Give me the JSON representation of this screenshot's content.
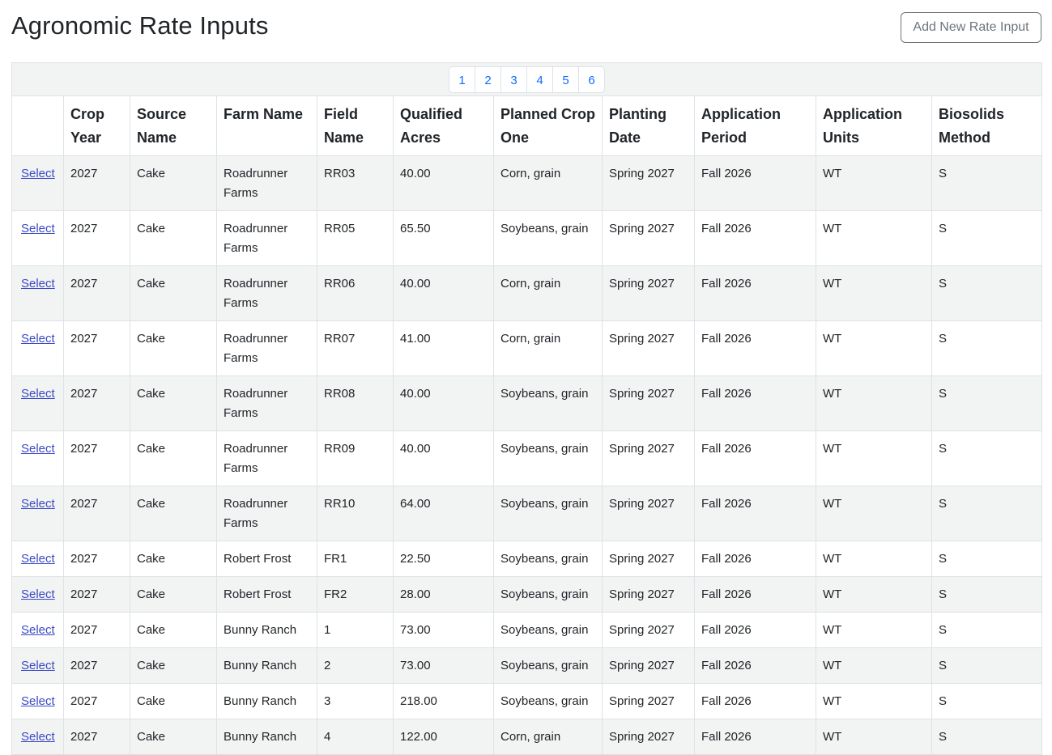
{
  "page": {
    "title": "Agronomic Rate Inputs",
    "add_button_label": "Add New Rate Input"
  },
  "pagination": {
    "pages": [
      "1",
      "2",
      "3",
      "4",
      "5",
      "6"
    ]
  },
  "columns": [
    "",
    "Crop Year",
    "Source Name",
    "Farm Name",
    "Field Name",
    "Qualified Acres",
    "Planned Crop One",
    "Planting Date",
    "Application Period",
    "Application Units",
    "Biosolids Method"
  ],
  "rows": [
    {
      "action": "Select",
      "crop_year": "2027",
      "source": "Cake",
      "farm": "Roadrunner Farms",
      "field": "RR03",
      "acres": "40.00",
      "crop": "Corn, grain",
      "planting": "Spring 2027",
      "period": "Fall 2026",
      "units": "WT",
      "method": "S"
    },
    {
      "action": "Select",
      "crop_year": "2027",
      "source": "Cake",
      "farm": "Roadrunner Farms",
      "field": "RR05",
      "acres": "65.50",
      "crop": "Soybeans, grain",
      "planting": "Spring 2027",
      "period": "Fall 2026",
      "units": "WT",
      "method": "S"
    },
    {
      "action": "Select",
      "crop_year": "2027",
      "source": "Cake",
      "farm": "Roadrunner Farms",
      "field": "RR06",
      "acres": "40.00",
      "crop": "Corn, grain",
      "planting": "Spring 2027",
      "period": "Fall 2026",
      "units": "WT",
      "method": "S"
    },
    {
      "action": "Select",
      "crop_year": "2027",
      "source": "Cake",
      "farm": "Roadrunner Farms",
      "field": "RR07",
      "acres": "41.00",
      "crop": "Corn, grain",
      "planting": "Spring 2027",
      "period": "Fall 2026",
      "units": "WT",
      "method": "S"
    },
    {
      "action": "Select",
      "crop_year": "2027",
      "source": "Cake",
      "farm": "Roadrunner Farms",
      "field": "RR08",
      "acres": "40.00",
      "crop": "Soybeans, grain",
      "planting": "Spring 2027",
      "period": "Fall 2026",
      "units": "WT",
      "method": "S"
    },
    {
      "action": "Select",
      "crop_year": "2027",
      "source": "Cake",
      "farm": "Roadrunner Farms",
      "field": "RR09",
      "acres": "40.00",
      "crop": "Soybeans, grain",
      "planting": "Spring 2027",
      "period": "Fall 2026",
      "units": "WT",
      "method": "S"
    },
    {
      "action": "Select",
      "crop_year": "2027",
      "source": "Cake",
      "farm": "Roadrunner Farms",
      "field": "RR10",
      "acres": "64.00",
      "crop": "Soybeans, grain",
      "planting": "Spring 2027",
      "period": "Fall 2026",
      "units": "WT",
      "method": "S"
    },
    {
      "action": "Select",
      "crop_year": "2027",
      "source": "Cake",
      "farm": "Robert Frost",
      "field": "FR1",
      "acres": "22.50",
      "crop": "Soybeans, grain",
      "planting": "Spring 2027",
      "period": "Fall 2026",
      "units": "WT",
      "method": "S"
    },
    {
      "action": "Select",
      "crop_year": "2027",
      "source": "Cake",
      "farm": "Robert Frost",
      "field": "FR2",
      "acres": "28.00",
      "crop": "Soybeans, grain",
      "planting": "Spring 2027",
      "period": "Fall 2026",
      "units": "WT",
      "method": "S"
    },
    {
      "action": "Select",
      "crop_year": "2027",
      "source": "Cake",
      "farm": "Bunny Ranch",
      "field": "1",
      "acres": "73.00",
      "crop": "Soybeans, grain",
      "planting": "Spring 2027",
      "period": "Fall 2026",
      "units": "WT",
      "method": "S"
    },
    {
      "action": "Select",
      "crop_year": "2027",
      "source": "Cake",
      "farm": "Bunny Ranch",
      "field": "2",
      "acres": "73.00",
      "crop": "Soybeans, grain",
      "planting": "Spring 2027",
      "period": "Fall 2026",
      "units": "WT",
      "method": "S"
    },
    {
      "action": "Select",
      "crop_year": "2027",
      "source": "Cake",
      "farm": "Bunny Ranch",
      "field": "3",
      "acres": "218.00",
      "crop": "Soybeans, grain",
      "planting": "Spring 2027",
      "period": "Fall 2026",
      "units": "WT",
      "method": "S"
    },
    {
      "action": "Select",
      "crop_year": "2027",
      "source": "Cake",
      "farm": "Bunny Ranch",
      "field": "4",
      "acres": "122.00",
      "crop": "Corn, grain",
      "planting": "Spring 2027",
      "period": "Fall 2026",
      "units": "WT",
      "method": "S"
    }
  ]
}
